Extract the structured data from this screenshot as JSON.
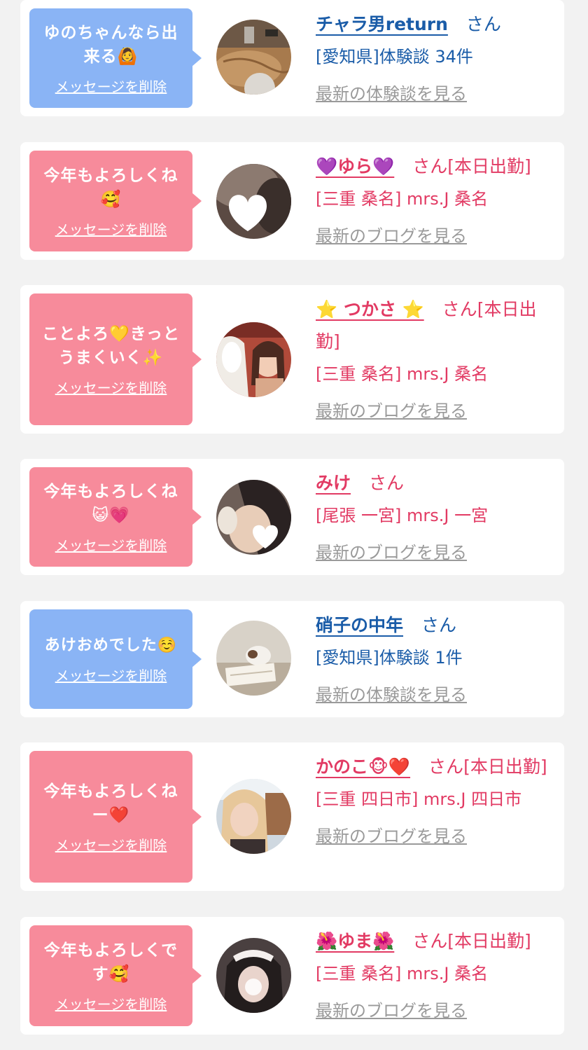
{
  "colors": {
    "bubble_blue": "#8ab4f5",
    "bubble_pink": "#f78b9b",
    "user_text_blue": "#1a5ca8",
    "cast_text_pink": "#e23a63",
    "link_gray": "#9a9a9a",
    "page_background": "#f2f2f2"
  },
  "messages": [
    {
      "bubble_color": "blue",
      "message": "ゆのちゃんなら出来る🙆",
      "delete_label": "メッセージを削除",
      "avatar_icon": "avatar-photo-cafe-table",
      "name": "チャラ男return",
      "san": "さん",
      "status": "",
      "detail": "[愛知県]体験談 34件",
      "latest_link": "最新の体験談を見る"
    },
    {
      "bubble_color": "pink",
      "message": "今年もよろしくね🥰",
      "delete_label": "メッセージを削除",
      "avatar_icon": "avatar-photo-woman-heart-sticker",
      "name": "💜ゆら💜",
      "san": "さん",
      "status": "[本日出勤]",
      "detail": "[三重 桑名] mrs.J 桑名",
      "latest_link": "最新のブログを見る"
    },
    {
      "bubble_color": "pink",
      "message": "ことよろ💛きっとうまくいく✨",
      "delete_label": "メッセージを削除",
      "avatar_icon": "avatar-photo-woman-white-horse",
      "name": "⭐ つかさ ⭐",
      "san": "さん",
      "status": "[本日出勤]",
      "detail": "[三重 桑名] mrs.J 桑名",
      "latest_link": "最新のブログを見る"
    },
    {
      "bubble_color": "pink",
      "message": "今年もよろしくね😺💗",
      "delete_label": "メッセージを削除",
      "avatar_icon": "avatar-photo-woman-heart-sticker",
      "name": "みけ",
      "san": "さん",
      "status": "",
      "detail": "[尾張 一宮] mrs.J 一宮",
      "latest_link": "最新のブログを見る"
    },
    {
      "bubble_color": "blue",
      "message": "あけおめでした☺️",
      "delete_label": "メッセージを削除",
      "avatar_icon": "avatar-photo-cat-notebook",
      "name": "硝子の中年",
      "san": "さん",
      "status": "",
      "detail": "[愛知県]体験談 1件",
      "latest_link": "最新の体験談を見る"
    },
    {
      "bubble_color": "pink",
      "message": "今年もよろしくねー❤️",
      "delete_label": "メッセージを削除",
      "avatar_icon": "avatar-photo-woman-blonde",
      "name": "かのこ🐵❤️",
      "san": "さん",
      "status": "[本日出勤]",
      "detail": "[三重 四日市] mrs.J 四日市",
      "latest_link": "最新のブログを見る"
    },
    {
      "bubble_color": "pink",
      "message": "今年もよろしくです🥰",
      "delete_label": "メッセージを削除",
      "avatar_icon": "avatar-photo-woman-maid",
      "name": "🌺ゆま🌺",
      "san": "さん",
      "status": "[本日出勤]",
      "detail": "[三重 桑名] mrs.J 桑名",
      "latest_link": "最新のブログを見る"
    }
  ]
}
